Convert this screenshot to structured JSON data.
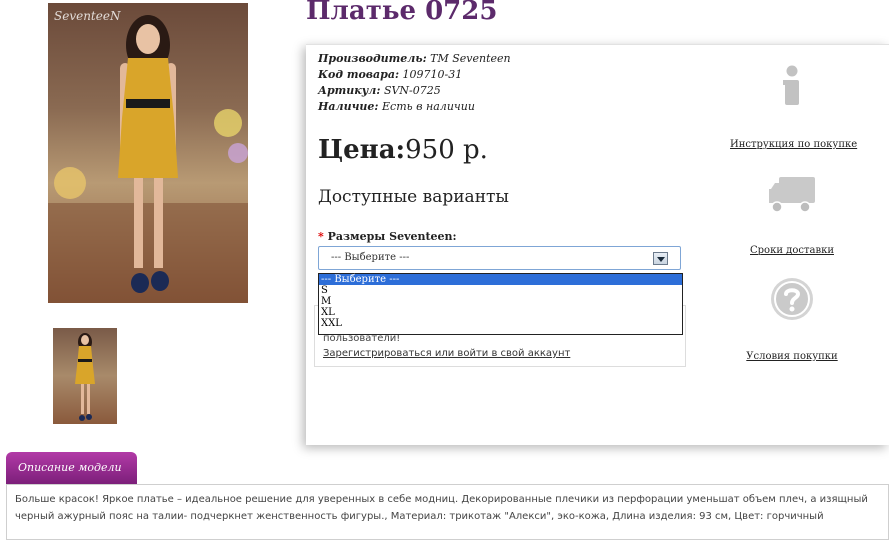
{
  "product": {
    "title": "Платье 0725",
    "main_photo_watermark": "SeventeeN",
    "specs": [
      {
        "label": "Производитель:",
        "value": "TM Seventeen"
      },
      {
        "label": "Код товара:",
        "value": "109710-31"
      },
      {
        "label": "Артикул:",
        "value": "SVN-0725"
      },
      {
        "label": "Наличие:",
        "value": "Есть в наличии"
      }
    ],
    "price_label": "Цена:",
    "price_value": "950 р.",
    "variants_title": "Доступные варианты",
    "size_required_mark": "*",
    "size_label": "Размеры Seventeen:",
    "size_select": {
      "selected": "--- Выберите ---",
      "options": [
        "--- Выберите ---",
        "S",
        "M",
        "XL",
        "XXL"
      ]
    },
    "login_note": "пользователи!",
    "login_link": "Зарегистрироваться или войти в свой аккаунт"
  },
  "side_info": [
    {
      "icon": "info-icon",
      "label": "Инструкция по покупке"
    },
    {
      "icon": "truck-icon",
      "label": "Сроки доставки"
    },
    {
      "icon": "question-icon",
      "label": "Условия покупки"
    }
  ],
  "description": {
    "tab_label": "Описание модели",
    "text": "Больше красок! Яркое платье – идеальное решение для уверенных в себе модниц. Декорированные плечики из перфорации уменьшат объем плеч, а изящный черный ажурный пояс на талии- подчеркнет женственность фигуры., Материал: трикотаж \"Алекси\", эко-кожа, Длина изделия: 93 см, Цвет: горчичный"
  },
  "colors": {
    "title": "#5c2a6b",
    "tab_gradient_top": "#b23aa7",
    "tab_gradient_bottom": "#7c1f7a",
    "dress": "#d9a52a",
    "dropdown_highlight": "#2d6ed8"
  }
}
